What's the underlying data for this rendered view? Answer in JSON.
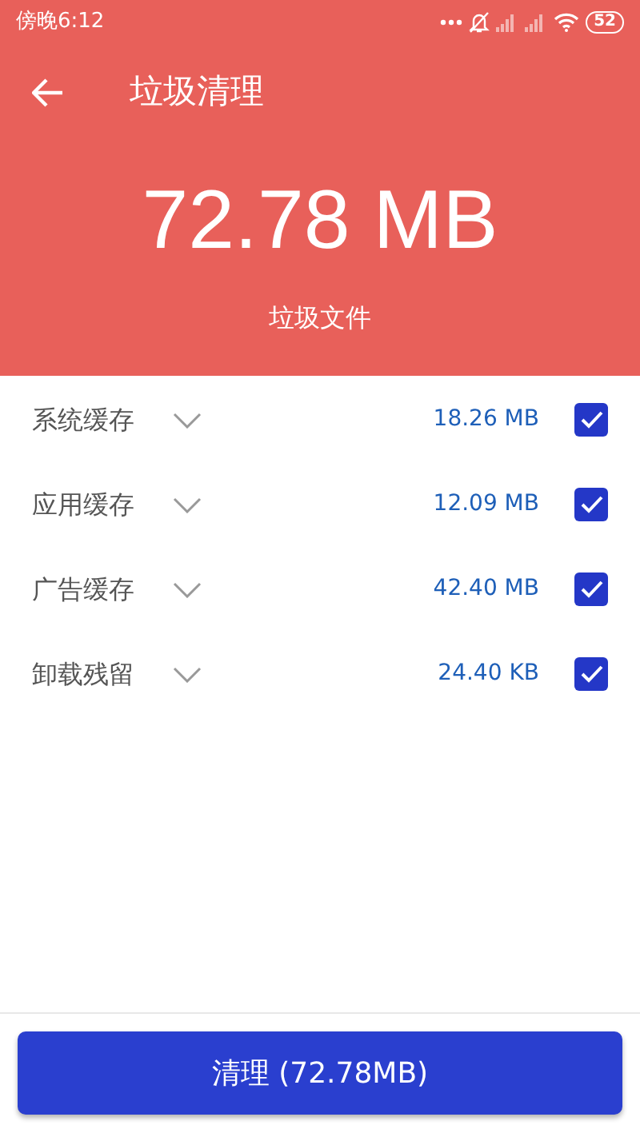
{
  "status_bar": {
    "time": "傍晚6:12",
    "battery": "52"
  },
  "header": {
    "title": "垃圾清理",
    "total": "72.78 MB",
    "subtitle": "垃圾文件"
  },
  "items": [
    {
      "label": "系统缓存",
      "size": "18.26 MB",
      "checked": true
    },
    {
      "label": "应用缓存",
      "size": "12.09 MB",
      "checked": true
    },
    {
      "label": "广告缓存",
      "size": "42.40 MB",
      "checked": true
    },
    {
      "label": "卸载残留",
      "size": "24.40 KB",
      "checked": true
    }
  ],
  "clean_button": {
    "label": "清理 (72.78MB)"
  }
}
